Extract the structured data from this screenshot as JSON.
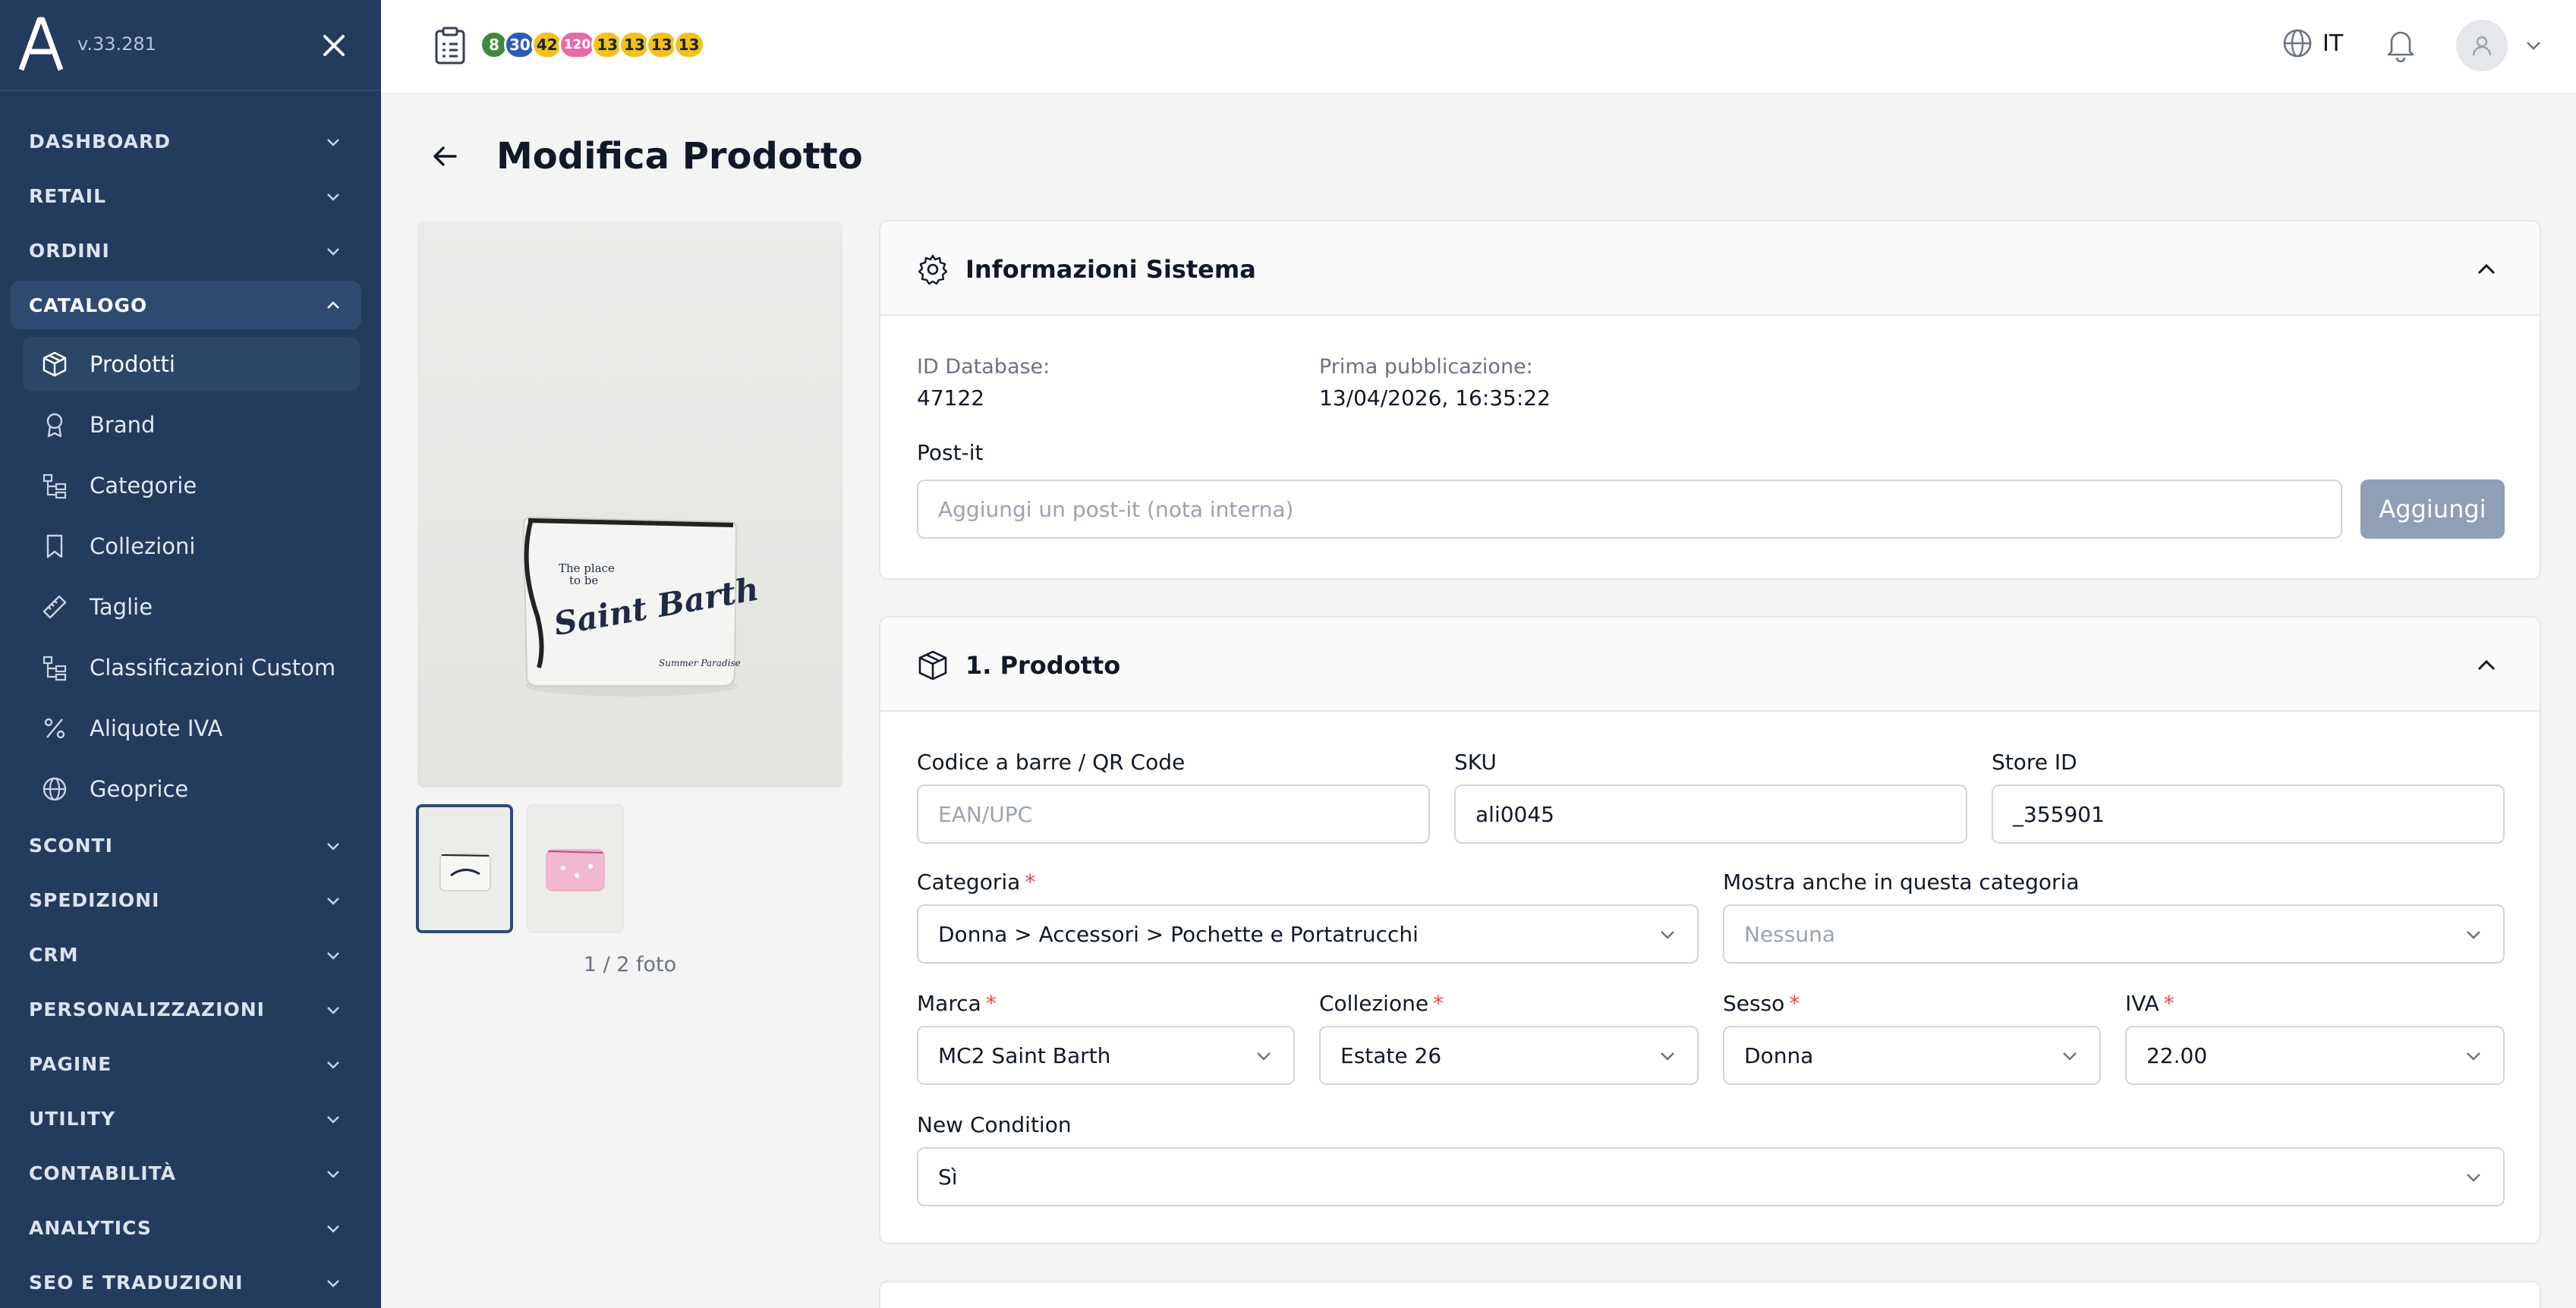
{
  "app": {
    "version": "v.33.281"
  },
  "sidebar": {
    "sections": [
      {
        "label": "DASHBOARD"
      },
      {
        "label": "RETAIL"
      },
      {
        "label": "ORDINI"
      },
      {
        "label": "CATALOGO",
        "expanded": true
      },
      {
        "label": "SCONTI"
      },
      {
        "label": "SPEDIZIONI"
      },
      {
        "label": "CRM"
      },
      {
        "label": "PERSONALIZZAZIONI"
      },
      {
        "label": "PAGINE"
      },
      {
        "label": "UTILITY"
      },
      {
        "label": "CONTABILITÀ"
      },
      {
        "label": "ANALYTICS"
      },
      {
        "label": "SEO E TRADUZIONI"
      }
    ],
    "catalog_items": [
      {
        "label": "Prodotti",
        "icon": "box-icon",
        "active": true
      },
      {
        "label": "Brand",
        "icon": "award-icon"
      },
      {
        "label": "Categorie",
        "icon": "tree-icon"
      },
      {
        "label": "Collezioni",
        "icon": "bookmark-icon"
      },
      {
        "label": "Taglie",
        "icon": "ruler-icon"
      },
      {
        "label": "Classificazioni Custom",
        "icon": "tree-icon"
      },
      {
        "label": "Aliquote IVA",
        "icon": "percent-icon"
      },
      {
        "label": "Geoprice",
        "icon": "globe-icon"
      }
    ]
  },
  "topbar": {
    "badges": [
      {
        "text": "8",
        "color": "#3f8a3a"
      },
      {
        "text": "30",
        "color": "#2b5cb8"
      },
      {
        "text": "42",
        "color": "#f2c21b"
      },
      {
        "text": "120",
        "color": "#e76ba9"
      },
      {
        "text": "13",
        "color": "#f2c21b"
      },
      {
        "text": "13",
        "color": "#f2c21b"
      },
      {
        "text": "13",
        "color": "#f2c21b"
      },
      {
        "text": "13",
        "color": "#f2c21b"
      }
    ],
    "language": "IT"
  },
  "page": {
    "title": "Modifica Prodotto"
  },
  "gallery": {
    "count": "1 / 2 foto"
  },
  "system_info": {
    "title": "Informazioni Sistema",
    "db_label": "ID Database:",
    "db_value": "47122",
    "pub_label": "Prima pubblicazione:",
    "pub_value": "13/04/2026, 16:35:22",
    "postit_label": "Post-it",
    "postit_placeholder": "Aggiungi un post-it (nota interna)",
    "add_label": "Aggiungi"
  },
  "product": {
    "title": "1. Prodotto",
    "barcode_label": "Codice a barre / QR Code",
    "barcode_placeholder": "EAN/UPC",
    "sku_label": "SKU",
    "sku_value": "ali0045",
    "store_label": "Store ID",
    "store_value": "_355901",
    "category_label": "Categoria",
    "category_value": "Donna > Accessori > Pochette e Portatrucchi",
    "also_label": "Mostra anche in questa categoria",
    "also_value": "Nessuna",
    "brand_label": "Marca",
    "brand_value": "MC2 Saint Barth",
    "collection_label": "Collezione",
    "collection_value": "Estate 26",
    "gender_label": "Sesso",
    "gender_value": "Donna",
    "vat_label": "IVA",
    "vat_value": "22.00",
    "condition_label": "New Condition",
    "condition_value": "Sì",
    "required_mark": "*"
  },
  "photo_text": {
    "line1": "The place",
    "line2": "to be",
    "brand": "Saint Barth",
    "sub": "Summer Paradise"
  }
}
